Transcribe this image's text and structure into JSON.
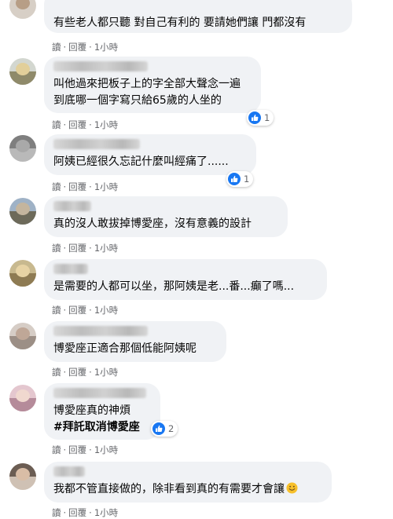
{
  "actions": {
    "reply": "讀",
    "sep": "·",
    "respond": "回覆",
    "time": "1小時"
  },
  "comments": [
    {
      "text": "有些老人都只聽 對自己有利的 要請她們讓 門都沒有"
    },
    {
      "text": "叫他過來把板子上的字全部大聲念一遍",
      "text2": "到底哪一個字寫只給65歲的人坐的",
      "likes": "1"
    },
    {
      "text": "阿姨已經很久忘記什麼叫經痛了......",
      "likes": "1"
    },
    {
      "text": "真的沒人敢拔掉博愛座，沒有意義的設計"
    },
    {
      "text": "是需要的人都可以坐，那阿姨是老...番...癲了嗎..."
    },
    {
      "text": "博愛座正適合那個低能阿姨呢"
    },
    {
      "text": "博愛座真的神煩",
      "tag": "#拜託取消博愛座",
      "likes": "2"
    },
    {
      "text": "我都不管直接做的，除非看到真的有需要才會讓"
    }
  ],
  "icons": [
    "like-icon",
    "smile-emoji-icon"
  ],
  "colors": {
    "bubble": "#f0f2f5",
    "meta": "#65676b",
    "like": "#1877f2",
    "emoji": "#f7c02b"
  }
}
